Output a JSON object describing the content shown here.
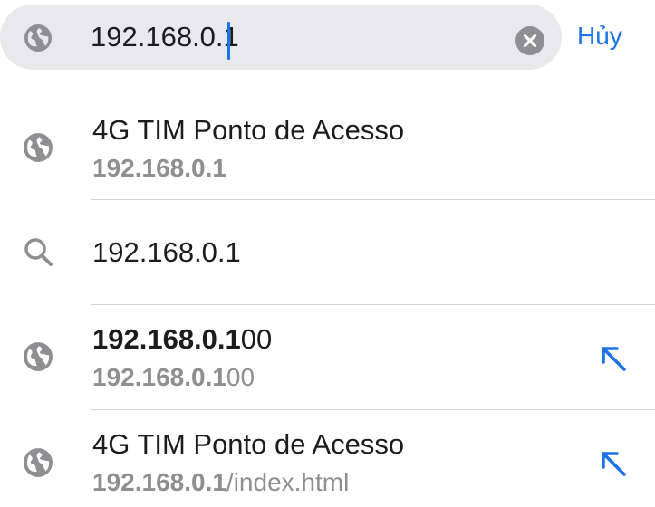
{
  "search": {
    "value": "192.168.0.1",
    "clear_icon": "clear-circle-icon",
    "cancel_label": "Hủy"
  },
  "suggestions": [
    {
      "icon": "globe-icon",
      "title": "4G TIM Ponto de Acesso",
      "subtitle_match": "192.168.0.1",
      "subtitle_rest": ""
    },
    {
      "icon": "search-icon",
      "title": "192.168.0.1"
    },
    {
      "icon": "globe-icon",
      "title_match": "192.168.0.1",
      "title_rest": "00",
      "subtitle_match": "192.168.0.1",
      "subtitle_rest": "00",
      "action_icon": "arrow-up-left-icon"
    },
    {
      "icon": "globe-icon",
      "title": "4G TIM Ponto de Acesso",
      "subtitle_match": "192.168.0.1",
      "subtitle_rest": "/index.html",
      "action_icon": "arrow-up-left-icon"
    }
  ],
  "colors": {
    "accent": "#1a73e8",
    "secondary_text": "#8e8e93",
    "search_field_bg": "#e9e9eb",
    "divider": "#d1d1d6"
  }
}
